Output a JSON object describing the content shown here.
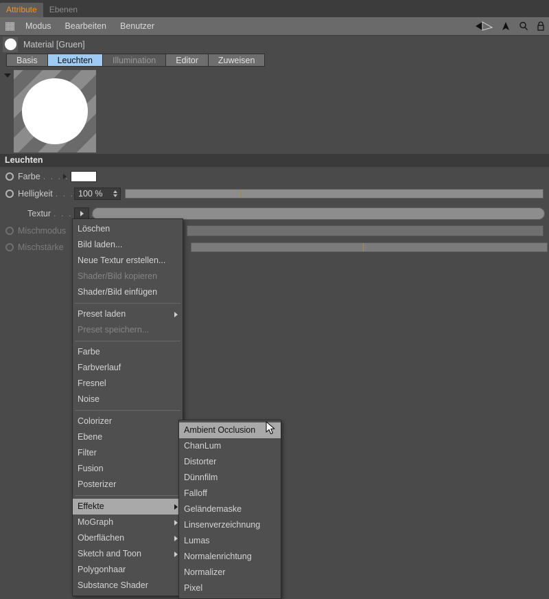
{
  "window": {
    "doc_tabs": [
      {
        "label": "Attribute",
        "active": true
      },
      {
        "label": "Ebenen",
        "active": false
      }
    ]
  },
  "menubar": {
    "grip_icon": "grip-dots-icon",
    "items": [
      "Modus",
      "Bearbeiten",
      "Benutzer"
    ],
    "right_icons": [
      "back-arrow-icon",
      "up-arrow-icon",
      "search-icon",
      "lock-icon"
    ]
  },
  "object_header": {
    "swatch_icon": "material-sphere-icon",
    "title": "Material [Gruen]"
  },
  "property_tabs": [
    {
      "label": "Basis",
      "state": "normal"
    },
    {
      "label": "Leuchten",
      "state": "active"
    },
    {
      "label": "Illumination",
      "state": "dim"
    },
    {
      "label": "Editor",
      "state": "normal"
    },
    {
      "label": "Zuweisen",
      "state": "normal"
    }
  ],
  "preview": {
    "collapse_icon": "triangle-down-icon",
    "sphere_icon": "white-sphere-icon"
  },
  "section": {
    "title": "Leuchten"
  },
  "params": [
    {
      "label": "Farbe",
      "dots": ". . . .",
      "enabled": true,
      "animicon": "anim-circle-icon"
    },
    {
      "label": "Helligkeit",
      "dots": ". . .",
      "enabled": true,
      "animicon": "anim-circle-icon",
      "value": "100 %"
    },
    {
      "label": "Textur",
      "dots": ". . . . . .",
      "enabled": true,
      "animicon": "none"
    },
    {
      "label": "Mischmodus",
      "dots": "",
      "enabled": false,
      "animicon": "anim-circle-icon"
    },
    {
      "label": "Mischstärke",
      "dots": "",
      "enabled": false,
      "animicon": "anim-circle-icon"
    }
  ],
  "context_menu": {
    "items": [
      {
        "label": "Löschen",
        "state": "normal"
      },
      {
        "label": "Bild laden...",
        "state": "normal"
      },
      {
        "label": "Neue Textur erstellen...",
        "state": "normal"
      },
      {
        "label": "Shader/Bild kopieren",
        "state": "disabled"
      },
      {
        "label": "Shader/Bild einfügen",
        "state": "normal"
      },
      {
        "label": "__sep__",
        "state": "separator"
      },
      {
        "label": "Preset laden",
        "state": "normal",
        "submenu": true
      },
      {
        "label": "Preset speichern...",
        "state": "disabled"
      },
      {
        "label": "__sep__",
        "state": "separator"
      },
      {
        "label": "Farbe",
        "state": "normal"
      },
      {
        "label": "Farbverlauf",
        "state": "normal"
      },
      {
        "label": "Fresnel",
        "state": "normal"
      },
      {
        "label": "Noise",
        "state": "normal"
      },
      {
        "label": "__sep__",
        "state": "separator"
      },
      {
        "label": "Colorizer",
        "state": "normal"
      },
      {
        "label": "Ebene",
        "state": "normal"
      },
      {
        "label": "Filter",
        "state": "normal"
      },
      {
        "label": "Fusion",
        "state": "normal"
      },
      {
        "label": "Posterizer",
        "state": "normal"
      },
      {
        "label": "__sep__",
        "state": "separator"
      },
      {
        "label": "Effekte",
        "state": "highlighted",
        "submenu": true
      },
      {
        "label": "MoGraph",
        "state": "normal",
        "submenu": true
      },
      {
        "label": "Oberflächen",
        "state": "normal",
        "submenu": true
      },
      {
        "label": "Sketch and Toon",
        "state": "normal",
        "submenu": true
      },
      {
        "label": "Polygonhaar",
        "state": "normal"
      },
      {
        "label": "Substance Shader",
        "state": "normal"
      }
    ]
  },
  "submenu": {
    "items": [
      {
        "label": "Ambient Occlusion",
        "state": "highlighted"
      },
      {
        "label": "ChanLum",
        "state": "normal"
      },
      {
        "label": "Distorter",
        "state": "normal"
      },
      {
        "label": "Dünnfilm",
        "state": "normal"
      },
      {
        "label": "Falloff",
        "state": "normal"
      },
      {
        "label": "Geländemaske",
        "state": "normal"
      },
      {
        "label": "Linsenverzeichnung",
        "state": "normal"
      },
      {
        "label": "Lumas",
        "state": "normal"
      },
      {
        "label": "Normalenrichtung",
        "state": "normal"
      },
      {
        "label": "Normalizer",
        "state": "normal"
      },
      {
        "label": "Pixel",
        "state": "normal"
      }
    ]
  },
  "cursor": {
    "icon": "mouse-pointer-icon"
  },
  "colors": {
    "accent_tab": "#f0941f",
    "active_tab_bg": "#9ecbf3",
    "panel_bg": "#4a4a4a",
    "menu_bg": "#4f4f4f",
    "menu_highlight": "#a9a9a9"
  }
}
